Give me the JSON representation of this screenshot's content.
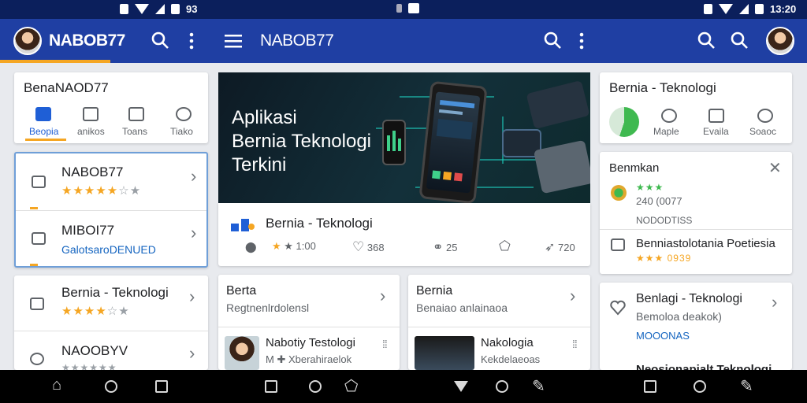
{
  "status": {
    "left_text": "93",
    "right_time": "13:20"
  },
  "appbar": {
    "left_title": "NABOB77",
    "center_title": "NABOB77"
  },
  "left_column": {
    "tab_card": {
      "title": "BenaNAOD77",
      "tabs": [
        "Beopia",
        "anikos",
        "Toans",
        "Tiako"
      ]
    },
    "list_card": {
      "items": [
        {
          "title": "NABOB77",
          "rating": 4,
          "sub": ""
        },
        {
          "title": "MIBOI77",
          "rating": 0,
          "sub": "GalotsaroDENUED"
        }
      ]
    },
    "list_card_2": {
      "items": [
        {
          "title": "Bernia - Teknologi",
          "rating": 4
        },
        {
          "title": "NAOOBYV",
          "rating": 0
        }
      ]
    }
  },
  "center_column": {
    "hero": {
      "line1": "Aplikasi",
      "line2": "Bernia Teknologi",
      "line3": "Terkini"
    },
    "detail": {
      "title": "Bernia - Teknologi",
      "rating_text": "★ 1:00",
      "likes": "368",
      "links": "25",
      "shares": "720"
    },
    "sub_cards": [
      {
        "title": "Berta",
        "sub": "Regtnenlrdolensl",
        "item_title": "Nabotiy Testologi",
        "item_sub": "M ✚ Xberahiraelok"
      },
      {
        "title": "Bernia",
        "sub": "Benaiao anlainaoa",
        "item_title": "Nakologia",
        "item_sub": "Kekdelaeoas"
      }
    ]
  },
  "right_column": {
    "app_card": {
      "title": "Bernia - Teknologi",
      "tabs": [
        "Maple",
        "Evaila",
        "Soaoc"
      ]
    },
    "notif_card": {
      "header": "Benmkan",
      "stars_text": "★★★",
      "line1": "240 (0077",
      "line2": "NODODTISS",
      "item_title": "Benniastolotania Poetiesia",
      "item_stars": "★★★ 0939"
    },
    "bottom_card": {
      "title": "Benlagi - Teknologi",
      "sub": "Bemoloa deakok)",
      "link": "MOOONAS",
      "bottom": "Neosionapialt Teknologi"
    }
  },
  "colors": {
    "appbar": "#1f3fa3",
    "statusbar": "#0b1f5c",
    "accent": "#f5a623",
    "link": "#1565c0",
    "hero_bg": "#0d1a24"
  }
}
